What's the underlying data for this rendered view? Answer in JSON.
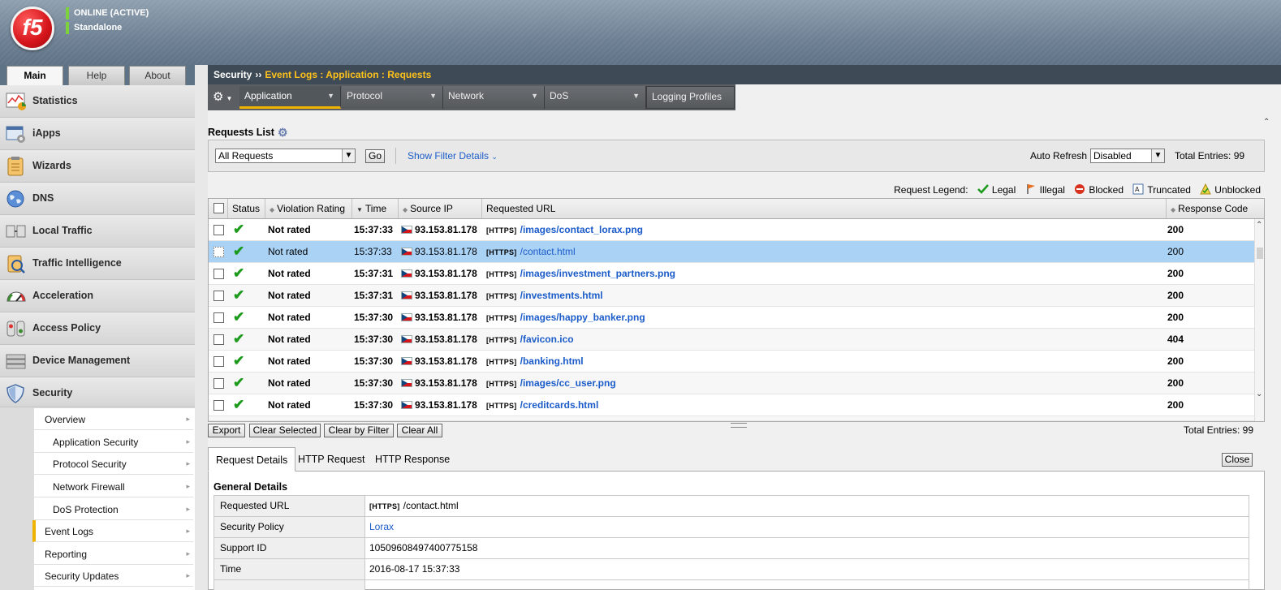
{
  "header": {
    "logo_text": "f5",
    "status_lines": [
      "ONLINE (ACTIVE)",
      "Standalone"
    ],
    "status_color": "#7cd13d"
  },
  "top_tabs": [
    {
      "label": "Main",
      "active": true
    },
    {
      "label": "Help",
      "active": false
    },
    {
      "label": "About",
      "active": false
    }
  ],
  "sidebar": {
    "items": [
      {
        "label": "Statistics",
        "icon": "statistics-icon"
      },
      {
        "label": "iApps",
        "icon": "iapps-icon"
      },
      {
        "label": "Wizards",
        "icon": "wizards-icon"
      },
      {
        "label": "DNS",
        "icon": "dns-globe-icon"
      },
      {
        "label": "Local Traffic",
        "icon": "local-traffic-icon"
      },
      {
        "label": "Traffic Intelligence",
        "icon": "traffic-intelligence-icon"
      },
      {
        "label": "Acceleration",
        "icon": "acceleration-gauge-icon"
      },
      {
        "label": "Access Policy",
        "icon": "access-policy-icon"
      },
      {
        "label": "Device Management",
        "icon": "device-management-icon"
      },
      {
        "label": "Security",
        "icon": "security-shield-icon"
      }
    ],
    "submenu": [
      {
        "label": "Overview",
        "indent": false,
        "active": false
      },
      {
        "label": "Application Security",
        "indent": true,
        "active": false
      },
      {
        "label": "Protocol Security",
        "indent": true,
        "active": false
      },
      {
        "label": "Network Firewall",
        "indent": true,
        "active": false
      },
      {
        "label": "DoS Protection",
        "indent": true,
        "active": false
      },
      {
        "label": "Event Logs",
        "indent": false,
        "active": true
      },
      {
        "label": "Reporting",
        "indent": false,
        "active": false
      },
      {
        "label": "Security Updates",
        "indent": false,
        "active": false
      }
    ]
  },
  "breadcrumb": {
    "root": "Security",
    "separator": "››",
    "current": "Event Logs : Application : Requests"
  },
  "nav_tabs": [
    {
      "label": "Application",
      "dropdown": true,
      "active": true
    },
    {
      "label": "Protocol",
      "dropdown": true,
      "active": false
    },
    {
      "label": "Network",
      "dropdown": true,
      "active": false
    },
    {
      "label": "DoS",
      "dropdown": true,
      "active": false
    },
    {
      "label": "Logging Profiles",
      "dropdown": false,
      "active": false
    }
  ],
  "requests_list": {
    "title": "Requests List",
    "filter_value": "All Requests",
    "go_label": "Go",
    "show_filter_label": "Show Filter Details",
    "auto_refresh_label": "Auto Refresh",
    "auto_refresh_value": "Disabled",
    "total_entries_label": "Total Entries: 99"
  },
  "legend": {
    "label": "Request Legend:",
    "items": [
      {
        "label": "Legal",
        "icon": "legal-check-icon"
      },
      {
        "label": "Illegal",
        "icon": "illegal-flag-icon"
      },
      {
        "label": "Blocked",
        "icon": "blocked-icon"
      },
      {
        "label": "Truncated",
        "icon": "truncated-icon"
      },
      {
        "label": "Unblocked",
        "icon": "unblocked-icon"
      }
    ]
  },
  "table": {
    "headers": {
      "status": "Status",
      "violation_rating": "Violation Rating",
      "time": "Time",
      "source_ip": "Source IP",
      "requested_url": "Requested URL",
      "response_code": "Response Code"
    },
    "rows": [
      {
        "rating": "Not rated",
        "time": "15:37:33",
        "ip": "93.153.81.178",
        "proto": "[HTTPS]",
        "url": "/images/contact_lorax.png",
        "code": "200",
        "selected": false
      },
      {
        "rating": "Not rated",
        "time": "15:37:33",
        "ip": "93.153.81.178",
        "proto": "[HTTPS]",
        "url": "/contact.html",
        "code": "200",
        "selected": true
      },
      {
        "rating": "Not rated",
        "time": "15:37:31",
        "ip": "93.153.81.178",
        "proto": "[HTTPS]",
        "url": "/images/investment_partners.png",
        "code": "200",
        "selected": false
      },
      {
        "rating": "Not rated",
        "time": "15:37:31",
        "ip": "93.153.81.178",
        "proto": "[HTTPS]",
        "url": "/investments.html",
        "code": "200",
        "selected": false
      },
      {
        "rating": "Not rated",
        "time": "15:37:30",
        "ip": "93.153.81.178",
        "proto": "[HTTPS]",
        "url": "/images/happy_banker.png",
        "code": "200",
        "selected": false
      },
      {
        "rating": "Not rated",
        "time": "15:37:30",
        "ip": "93.153.81.178",
        "proto": "[HTTPS]",
        "url": "/favicon.ico",
        "code": "404",
        "selected": false
      },
      {
        "rating": "Not rated",
        "time": "15:37:30",
        "ip": "93.153.81.178",
        "proto": "[HTTPS]",
        "url": "/banking.html",
        "code": "200",
        "selected": false
      },
      {
        "rating": "Not rated",
        "time": "15:37:30",
        "ip": "93.153.81.178",
        "proto": "[HTTPS]",
        "url": "/images/cc_user.png",
        "code": "200",
        "selected": false
      },
      {
        "rating": "Not rated",
        "time": "15:37:30",
        "ip": "93.153.81.178",
        "proto": "[HTTPS]",
        "url": "/creditcards.html",
        "code": "200",
        "selected": false
      }
    ]
  },
  "actions": {
    "export": "Export",
    "clear_selected": "Clear Selected",
    "clear_by_filter": "Clear by Filter",
    "clear_all": "Clear All",
    "total_entries": "Total Entries: 99"
  },
  "details": {
    "tabs": [
      "Request Details",
      "HTTP Request",
      "HTTP Response"
    ],
    "close_label": "Close",
    "section_title": "General Details",
    "rows": [
      {
        "key": "Requested URL",
        "proto": "[HTTPS]",
        "value": "/contact.html",
        "link": false
      },
      {
        "key": "Security Policy",
        "proto": "",
        "value": "Lorax",
        "link": true
      },
      {
        "key": "Support ID",
        "proto": "",
        "value": "10509608497400775158",
        "link": false
      },
      {
        "key": "Time",
        "proto": "",
        "value": "2016-08-17 15:37:33",
        "link": false
      }
    ]
  },
  "colors": {
    "accent": "#f0b400",
    "link": "#1b5cc9",
    "selected_row": "#a9d2f5",
    "header_dark": "#3e4a55"
  }
}
